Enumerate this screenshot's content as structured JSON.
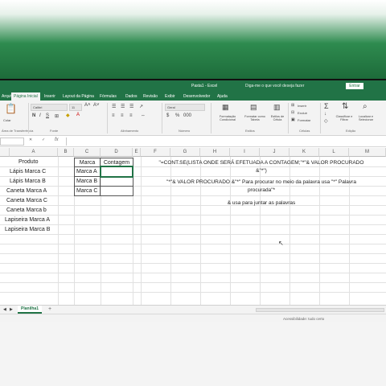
{
  "window": {
    "title": "Pasta1 - Excel",
    "search": "Diga-me o que você deseja fazer",
    "signin": "Entrar"
  },
  "tabs": [
    "Arquivo",
    "Página Inicial",
    "Inserir",
    "Layout da Página",
    "Fórmulas",
    "Dados",
    "Revisão",
    "Exibir",
    "Desenvolvedor",
    "Ajuda"
  ],
  "ribbon": {
    "font_name": "Calibri",
    "font_size": "11",
    "number_format": "Geral",
    "paste": "Colar",
    "groups": [
      "Área de Transferência",
      "Fonte",
      "Alinhamento",
      "Número",
      "Estilos",
      "Células",
      "Edição"
    ],
    "cond_format": "Formatação Condicional",
    "format_table": "Formatar como Tabela",
    "cell_styles": "Estilos de Célula",
    "insert": "Inserir",
    "delete": "Excluir",
    "format": "Formatar",
    "sort": "Classificar e Filtrar",
    "find": "Localizar e Selecionar"
  },
  "formula_bar": {
    "name_box": "",
    "fx": "fx"
  },
  "columns": [
    "A",
    "B",
    "C",
    "D",
    "E",
    "F",
    "G",
    "H",
    "I",
    "J",
    "K",
    "L",
    "M"
  ],
  "column_a": [
    "Produto",
    "Lápis Marca C",
    "Lápis Marca B",
    "Caneta Marca A",
    "Caneta Marca C",
    "Caneta Marca b",
    "Lapiseira Marca A",
    "Lapiseira Marca B"
  ],
  "table": {
    "header_marca": "Marca",
    "header_contagem": "Contagem",
    "marcas": [
      "Marca A",
      "Marca B",
      "Marca C"
    ]
  },
  "notes": {
    "line1": "\"=CONT.SE(LISTA ONDE SERÁ EFETUADA A CONTAGEM;\"*\"& VALOR PROCURADO",
    "line2": "&\"*\")",
    "line3": "\"*\"& VALOR PROCURADO &\"*\" Para procurar no meio da palavra usa \"*\" Palavra",
    "line4": "procurada\"*",
    "line5": "& usa para juntar as palavras"
  },
  "sheets": {
    "tab": "Planilha1",
    "add": "+"
  },
  "status": {
    "mode": "",
    "accessibility": "Acessibilidade: tudo certo"
  },
  "colors": {
    "excel_green": "#217346"
  }
}
